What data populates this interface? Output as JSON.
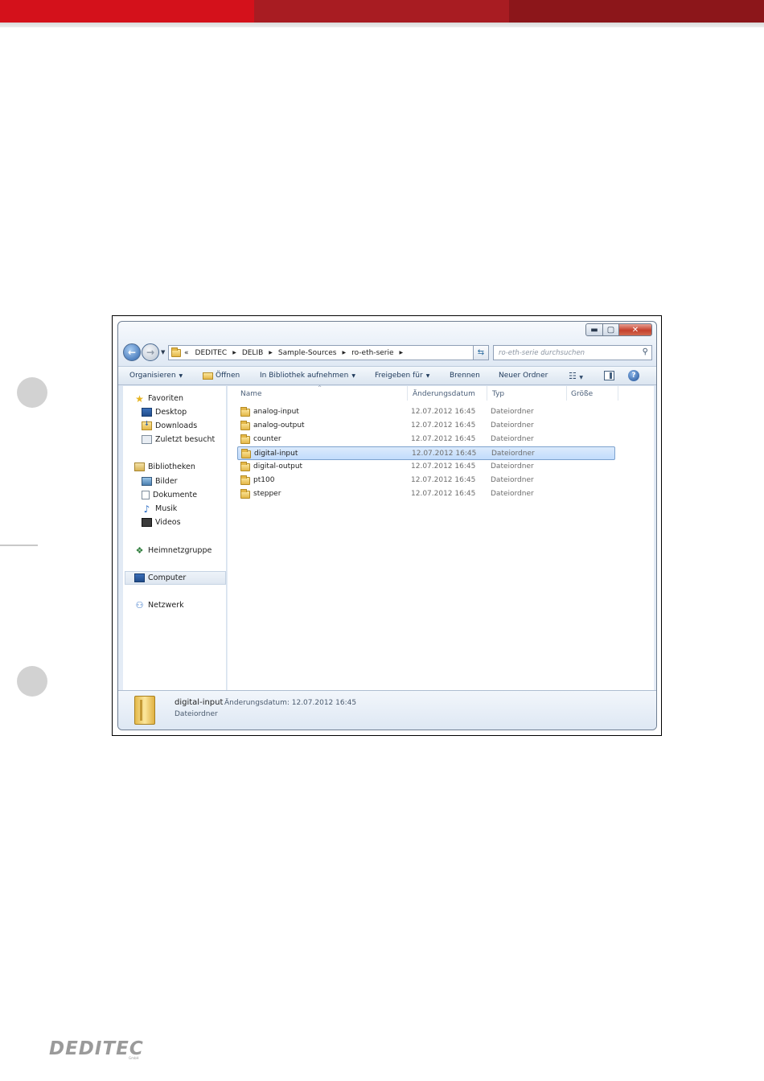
{
  "page": {
    "logo_text": "DEDITEC",
    "logo_sub": "GmbH"
  },
  "window": {
    "caption": {
      "minimize": "▬",
      "maximize": "▢",
      "close": "✕"
    },
    "address": {
      "crumbs": [
        "«",
        "DEDITEC",
        "DELIB",
        "Sample-Sources",
        "ro-eth-serie"
      ],
      "search_placeholder": "ro-eth-serie durchsuchen"
    },
    "commands": {
      "organize": "Organisieren",
      "open": "Öffnen",
      "library": "In Bibliothek aufnehmen",
      "share": "Freigeben für",
      "burn": "Brennen",
      "new_folder": "Neuer Ordner"
    },
    "nav": {
      "favorites": "Favoriten",
      "desktop": "Desktop",
      "downloads": "Downloads",
      "recent": "Zuletzt besucht",
      "libraries": "Bibliotheken",
      "pictures": "Bilder",
      "documents": "Dokumente",
      "music": "Musik",
      "videos": "Videos",
      "homegroup": "Heimnetzgruppe",
      "computer": "Computer",
      "network": "Netzwerk"
    },
    "columns": {
      "name": "Name",
      "date": "Änderungsdatum",
      "type": "Typ",
      "size": "Größe"
    },
    "files": [
      {
        "name": "analog-input",
        "date": "12.07.2012 16:45",
        "type": "Dateiordner"
      },
      {
        "name": "analog-output",
        "date": "12.07.2012 16:45",
        "type": "Dateiordner"
      },
      {
        "name": "counter",
        "date": "12.07.2012 16:45",
        "type": "Dateiordner"
      },
      {
        "name": "digital-input",
        "date": "12.07.2012 16:45",
        "type": "Dateiordner"
      },
      {
        "name": "digital-output",
        "date": "12.07.2012 16:45",
        "type": "Dateiordner"
      },
      {
        "name": "pt100",
        "date": "12.07.2012 16:45",
        "type": "Dateiordner"
      },
      {
        "name": "stepper",
        "date": "12.07.2012 16:45",
        "type": "Dateiordner"
      }
    ],
    "selected_index": 3,
    "details": {
      "name": "digital-input",
      "modified": "Änderungsdatum: 12.07.2012 16:45",
      "type": "Dateiordner"
    }
  }
}
